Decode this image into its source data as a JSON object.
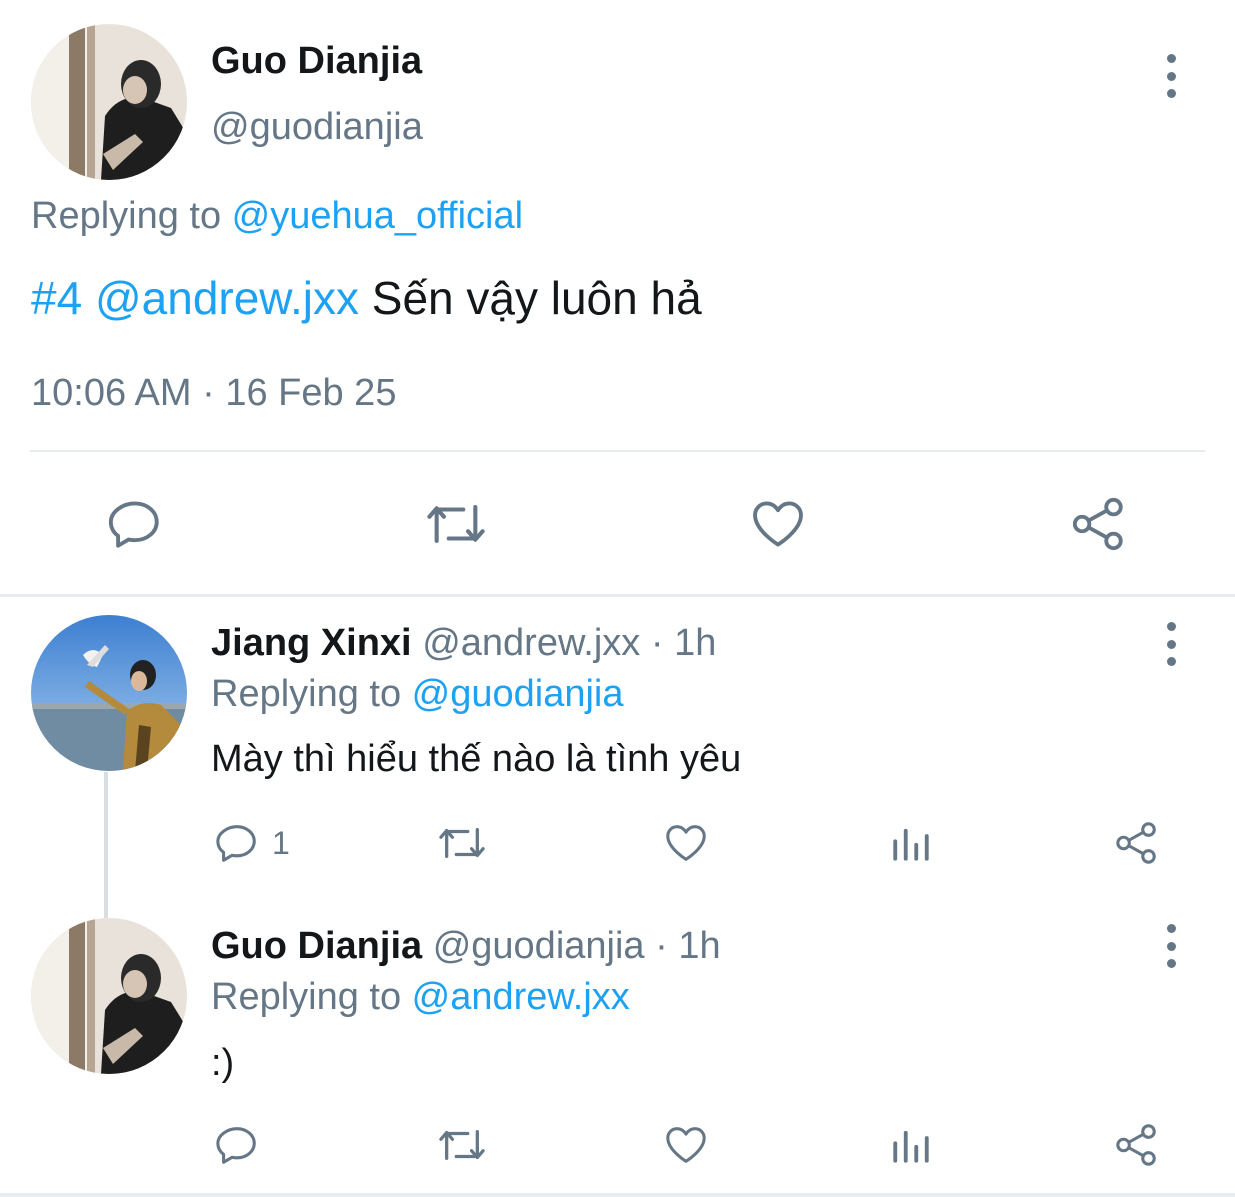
{
  "main_tweet": {
    "author_name": "Guo Dianjia",
    "author_handle": "@guodianjia",
    "replying_prefix": "Replying to ",
    "replying_handle": "@yuehua_official",
    "text_hashtag": "#4",
    "text_mention": "@andrew.jxx",
    "text_body": " Sến vậy luôn hả",
    "timestamp": "10:06 AM · 16 Feb 25",
    "actions": [
      "reply-icon",
      "retweet-icon",
      "like-icon",
      "share-icon"
    ]
  },
  "replies": [
    {
      "author_name": "Jiang Xinxi",
      "author_handle": "@andrew.jxx",
      "time": " · 1h",
      "replying_prefix": "Replying to ",
      "replying_handle": "@guodianjia",
      "text": "Mày thì hiểu thế nào là tình yêu",
      "reply_count": "1"
    },
    {
      "author_name": "Guo Dianjia",
      "author_handle": "@guodianjia",
      "time": " · 1h",
      "replying_prefix": "Replying to ",
      "replying_handle": "@andrew.jxx",
      "text": ":)",
      "reply_count": ""
    }
  ],
  "colors": {
    "link": "#1da1f2",
    "muted": "#657786",
    "text": "#14171a",
    "divider": "#e6ecf0"
  }
}
